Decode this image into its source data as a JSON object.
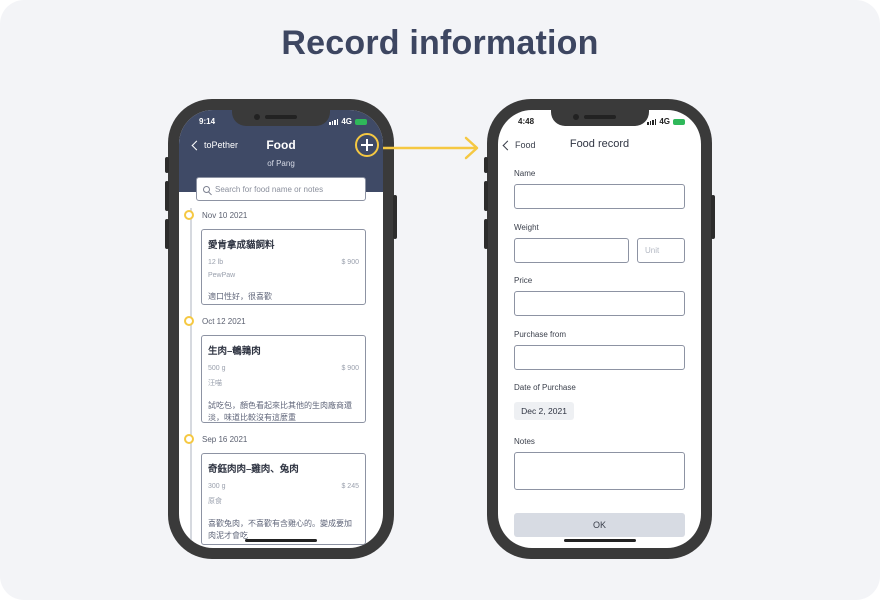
{
  "page": {
    "title": "Record information"
  },
  "left_phone": {
    "status_time": "9:14",
    "status_network": "4G",
    "nav": {
      "back_label": "toPether",
      "title": "Food",
      "subtitle": "of Pang",
      "add_icon": "plus-icon"
    },
    "search": {
      "placeholder": "Search for food name or notes"
    },
    "entries": [
      {
        "date": "Nov 10 2021",
        "name": "愛肯拿成貓飼料",
        "qty": "12 lb",
        "price": "$ 900",
        "brand": "PewPaw",
        "note": "適口性好，很喜歡"
      },
      {
        "date": "Oct 12 2021",
        "name": "生肉–鵪鶉肉",
        "qty": "500 g",
        "price": "$ 900",
        "brand": "汪喵",
        "note": "試吃包，顏色看起來比其他的生肉廠商還淡，味道比較沒有這麼重"
      },
      {
        "date": "Sep 16 2021",
        "name": "奇鈺肉肉–雞肉、兔肉",
        "qty": "300 g",
        "price": "$ 245",
        "brand": "原食",
        "note": "喜歡兔肉，不喜歡有含雞心的。變成要加肉泥才會吃"
      }
    ]
  },
  "right_phone": {
    "status_time": "4:48",
    "status_network": "4G",
    "nav": {
      "back_label": "Food",
      "title": "Food record"
    },
    "form": {
      "name_label": "Name",
      "weight_label": "Weight",
      "unit_placeholder": "Unit",
      "price_label": "Price",
      "purchase_from_label": "Purchase from",
      "date_label": "Date of Purchase",
      "date_value": "Dec 2, 2021",
      "notes_label": "Notes",
      "ok_label": "OK"
    }
  },
  "colors": {
    "header": "#3f4a66",
    "accent": "#f5c842",
    "background": "#f3f4f7"
  }
}
